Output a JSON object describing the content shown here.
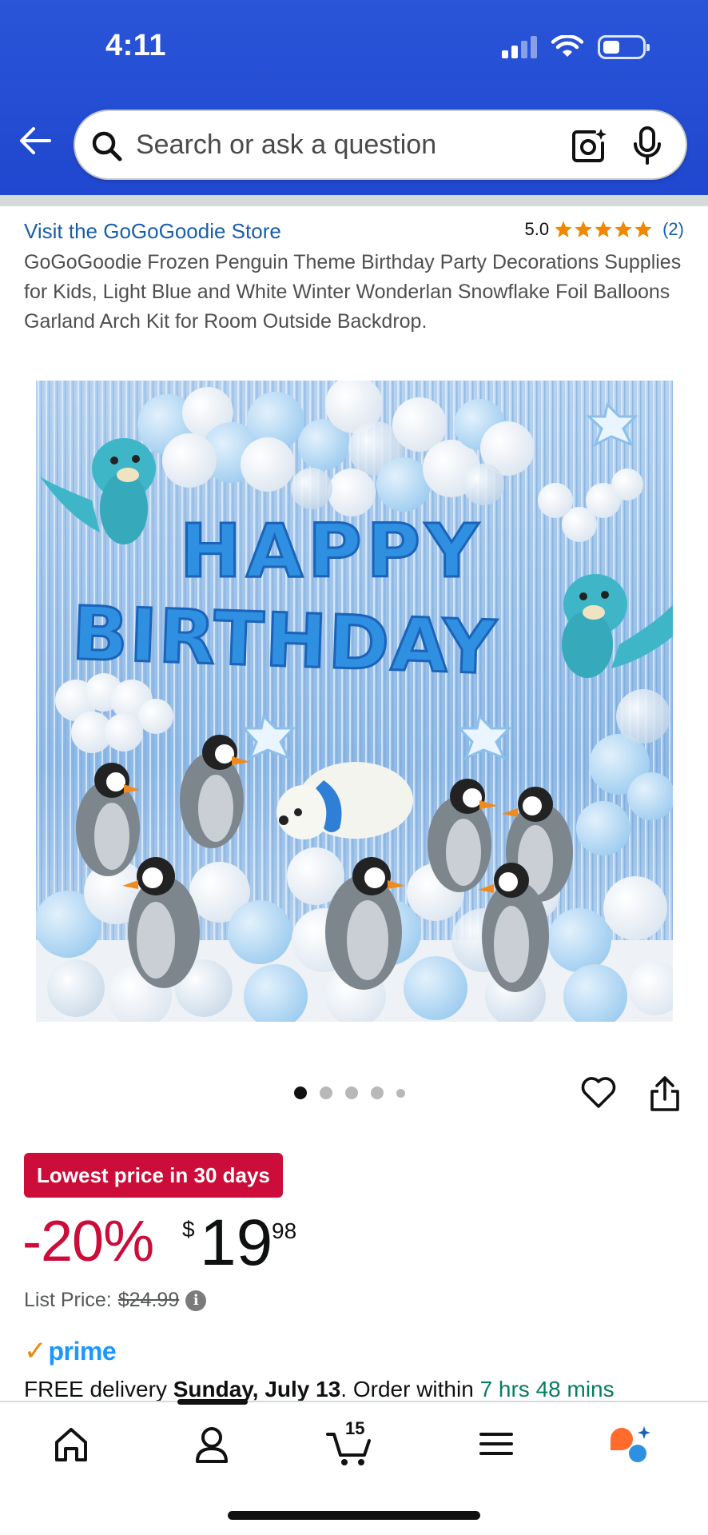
{
  "status_bar": {
    "time": "4:11"
  },
  "search": {
    "placeholder": "Search or ask a question"
  },
  "product": {
    "store_link": "Visit the GoGoGoodie Store",
    "rating_value": "5.0",
    "rating_stars": 5,
    "rating_count": "(2)",
    "title": "GoGoGoodie Frozen Penguin Theme Birthday Party Decorations Supplies for Kids, Light Blue and White Winter Wonderlan Snowflake Foil Balloons Garland Arch Kit for Room Outside Backdrop.",
    "image_text": {
      "line1": "HAPPY",
      "line2": "BIRTHDAY"
    },
    "carousel": {
      "total_images": 5,
      "current_index": 1
    }
  },
  "pricing": {
    "deal_badge": "Lowest price in 30 days",
    "discount": "-20%",
    "currency_symbol": "$",
    "price_whole": "19",
    "price_fraction": "98",
    "list_price_label": "List Price:",
    "list_price_value": "$24.99"
  },
  "prime": {
    "check": "✓",
    "word": "prime"
  },
  "delivery": {
    "prefix": "FREE delivery ",
    "date": "Sunday, July 13",
    "middle": ". Order within ",
    "countdown": "7 hrs 48 mins"
  },
  "tabbar": {
    "cart_count": "15"
  },
  "colors": {
    "header_blue": "#2a55d8",
    "deal_red": "#cc0c39",
    "link_blue": "#1a5ea8",
    "star_orange": "#f08804",
    "prime_blue": "#1a98ff",
    "countdown_green": "#067d62"
  },
  "icons": [
    "back-arrow-icon",
    "search-icon",
    "camera-lens-icon",
    "microphone-icon",
    "heart-icon",
    "share-icon",
    "home-icon",
    "account-icon",
    "cart-icon",
    "menu-icon",
    "rufus-icon",
    "info-icon",
    "star-icon"
  ]
}
